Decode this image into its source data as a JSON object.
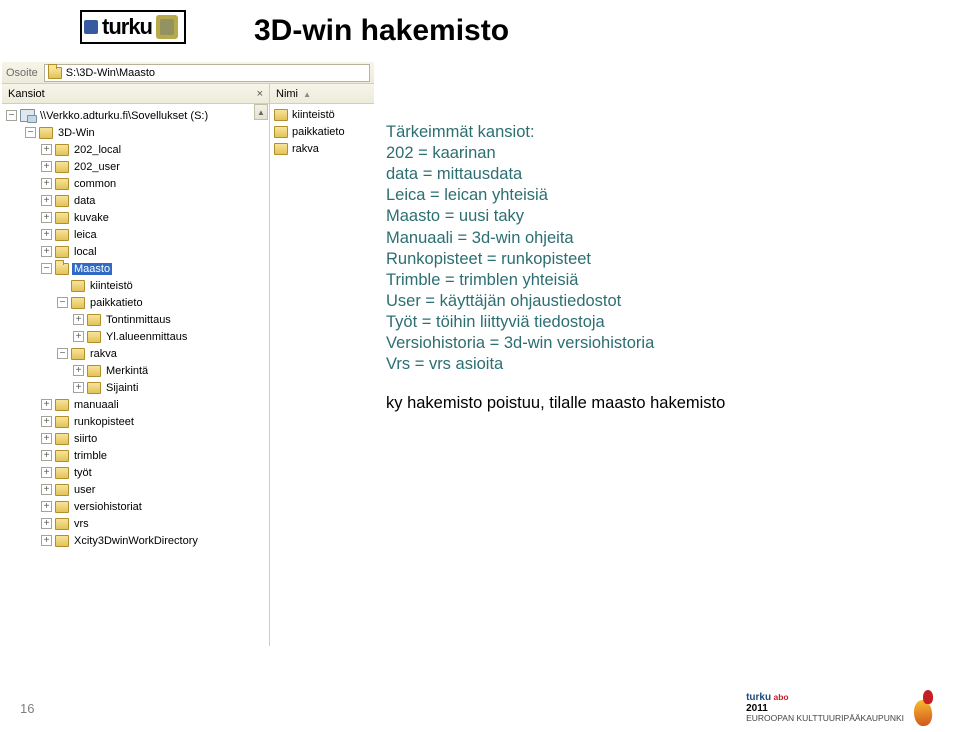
{
  "logo": {
    "text": "turku"
  },
  "title": "3D-win hakemisto",
  "explorer": {
    "addr_label": "Osoite",
    "addr_path": "S:\\3D-Win\\Maasto",
    "left_header": "Kansiot",
    "right_header": "Nimi",
    "root": "\\\\Verkko.adturku.fi\\Sovellukset (S:)",
    "tree": [
      {
        "level": 1,
        "tw": "-",
        "icon": "folder",
        "label": "3D-Win"
      },
      {
        "level": 2,
        "tw": "+",
        "icon": "folder",
        "label": "202_local"
      },
      {
        "level": 2,
        "tw": "+",
        "icon": "folder",
        "label": "202_user"
      },
      {
        "level": 2,
        "tw": "+",
        "icon": "folder",
        "label": "common"
      },
      {
        "level": 2,
        "tw": "+",
        "icon": "folder",
        "label": "data"
      },
      {
        "level": 2,
        "tw": "+",
        "icon": "folder",
        "label": "kuvake"
      },
      {
        "level": 2,
        "tw": "+",
        "icon": "folder",
        "label": "leica"
      },
      {
        "level": 2,
        "tw": "+",
        "icon": "folder",
        "label": "local"
      },
      {
        "level": 2,
        "tw": "-",
        "icon": "folder",
        "label": "Maasto",
        "selected": true
      },
      {
        "level": 3,
        "tw": " ",
        "icon": "folder",
        "label": "kiinteistö"
      },
      {
        "level": 3,
        "tw": "-",
        "icon": "folder",
        "label": "paikkatieto"
      },
      {
        "level": 4,
        "tw": "+",
        "icon": "folder",
        "label": "Tontinmittaus"
      },
      {
        "level": 4,
        "tw": "+",
        "icon": "folder",
        "label": "Yl.alueenmittaus"
      },
      {
        "level": 3,
        "tw": "-",
        "icon": "folder",
        "label": "rakva"
      },
      {
        "level": 4,
        "tw": "+",
        "icon": "folder",
        "label": "Merkintä"
      },
      {
        "level": 4,
        "tw": "+",
        "icon": "folder",
        "label": "Sijainti"
      },
      {
        "level": 2,
        "tw": "+",
        "icon": "folder",
        "label": "manuaali"
      },
      {
        "level": 2,
        "tw": "+",
        "icon": "folder",
        "label": "runkopisteet"
      },
      {
        "level": 2,
        "tw": "+",
        "icon": "folder",
        "label": "siirto"
      },
      {
        "level": 2,
        "tw": "+",
        "icon": "folder",
        "label": "trimble"
      },
      {
        "level": 2,
        "tw": "+",
        "icon": "folder",
        "label": "työt"
      },
      {
        "level": 2,
        "tw": "+",
        "icon": "folder",
        "label": "user"
      },
      {
        "level": 2,
        "tw": "+",
        "icon": "folder",
        "label": "versiohistoriat"
      },
      {
        "level": 2,
        "tw": "+",
        "icon": "folder",
        "label": "vrs"
      },
      {
        "level": 2,
        "tw": "+",
        "icon": "folder",
        "label": "Xcity3DwinWorkDirectory"
      }
    ],
    "right_items": [
      "kiinteistö",
      "paikkatieto",
      "rakva"
    ]
  },
  "info": {
    "heading": "Tärkeimmät kansiot:",
    "lines": [
      "202 = kaarinan",
      "data = mittausdata",
      "Leica = leican yhteisiä",
      "Maasto = uusi taky",
      "Manuaali = 3d-win ohjeita",
      "Runkopisteet = runkopisteet",
      "Trimble = trimblen yhteisiä",
      "User = käyttäjän ohjaustiedostot",
      "Työt = töihin liittyviä tiedostoja",
      "Versiohistoria = 3d-win versiohistoria",
      "Vrs = vrs asioita"
    ],
    "note": "ky hakemisto poistuu, tilalle maasto hakemisto"
  },
  "footer": {
    "page": "16",
    "brand1": "turku",
    "brand2": "abo",
    "year": "2011",
    "tagline": "EUROOPAN KULTTUURIPÄÄKAUPUNKI"
  }
}
